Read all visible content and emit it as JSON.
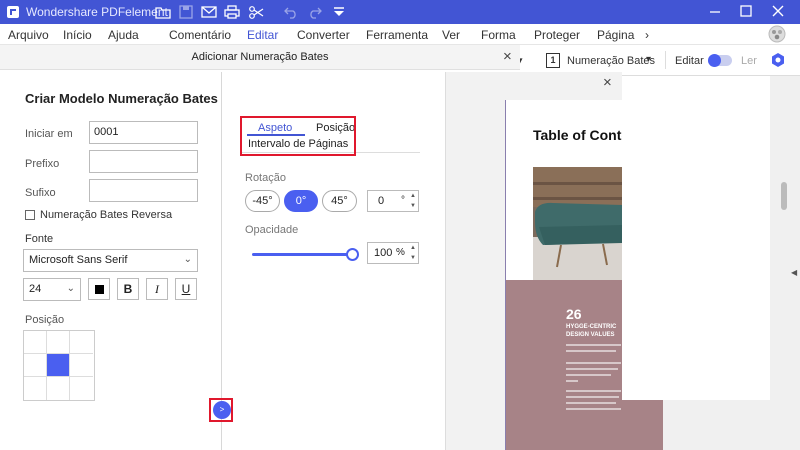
{
  "app": {
    "title": "Wondershare PDFelement"
  },
  "menu": {
    "items": [
      "Arquivo",
      "Início",
      "Ajuda",
      "Comentário",
      "Editar",
      "Converter",
      "Ferramenta",
      "Ver",
      "Forma",
      "Proteger",
      "Página"
    ],
    "active": "Editar",
    "more": "›"
  },
  "subtoolbar": {
    "bates_label": "Numeração Bates",
    "bates_icon_text": "1",
    "edit_label": "Editar",
    "read_label": "Ler"
  },
  "dialog": {
    "title": "Adicionar Numeração Bates",
    "close": "×"
  },
  "left": {
    "title": "Criar Modelo Numeração Bates",
    "start_label": "Iniciar em",
    "start_value": "0001",
    "prefix_label": "Prefixo",
    "prefix_value": "",
    "suffix_label": "Sufixo",
    "suffix_value": "",
    "reverse_label": "Numeração Bates Reversa",
    "font_label": "Fonte",
    "font_value": "Microsoft Sans Serif",
    "size_value": "24",
    "bold": "B",
    "italic": "I",
    "underline": "U",
    "position_label": "Posição",
    "position_selected": "middle-center"
  },
  "right": {
    "tabs": [
      "Aspeto",
      "Posição",
      "Intervalo de Páginas"
    ],
    "active_tab": "Aspeto",
    "rotation_label": "Rotação",
    "rotation_options": [
      "-45°",
      "0°",
      "45°"
    ],
    "rotation_selected": "0°",
    "rotation_value": "0",
    "rotation_unit": "°",
    "opacity_label": "Opacidade",
    "opacity_value": "100",
    "opacity_unit": "%",
    "opacity_fraction": 1.0,
    "collapse_icon_text": ">"
  },
  "preview": {
    "close": "×",
    "page_title": "Table of Conte",
    "page_number": "26",
    "page_subtitle": "HYGGE-CENTRIC DESIGN VALUES"
  },
  "colors": {
    "titlebar": "#4255d4",
    "accent": "#4a5ff0",
    "highlight_box": "#e0182d",
    "page_block": "#a78387"
  }
}
